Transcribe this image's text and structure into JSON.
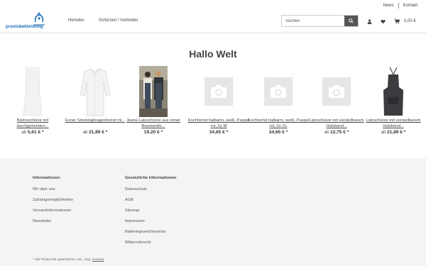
{
  "topbar": {
    "links": [
      "News",
      "Kontakt"
    ]
  },
  "header": {
    "logo_text": "praxisbekleidung",
    "nav": [
      "Hemden",
      "Schürzen / Vorbinder"
    ],
    "search_placeholder": "Suchen",
    "cart_total": "0,00 €"
  },
  "headline": "Hallo Welt",
  "products": [
    {
      "title": "Bistroschürze mit durchgehenden...",
      "prefix": "ab",
      "price": "5,61 € *",
      "image": "apron-white"
    },
    {
      "title": "Exner Smokingkragenhemd mi...",
      "prefix": "ab",
      "price": "21,89 € *",
      "image": "shirt-white"
    },
    {
      "title": "Jeans-Latzschürze aus reiner Baumwolle...",
      "prefix": "",
      "price": "19,20 € *",
      "image": "photo-people"
    },
    {
      "title": "Kochhemd halbarm, weiß, Paspel rot, Gr M",
      "prefix": "",
      "price": "34,65 € *",
      "image": "camera-placeholder"
    },
    {
      "title": "Kochhemd halbarm, weiß, Paspel rot, Gr XL",
      "prefix": "",
      "price": "34,65 € *",
      "image": "camera-placeholder"
    },
    {
      "title": "Latzschürze mit verstellbarem Halsband...",
      "prefix": "ab",
      "price": "12,75 € *",
      "image": "camera-placeholder"
    },
    {
      "title": "Latzschürze mit verstellbarem Halsband...",
      "prefix": "ab",
      "price": "21,89 € *",
      "image": "apron-dark"
    }
  ],
  "footer": {
    "col1": {
      "heading": "Informationen",
      "links": [
        "Wir über uns",
        "Zahlungsmöglichkeiten",
        "Versandinformationen",
        "Newsletter"
      ]
    },
    "col2": {
      "heading": "Gesetzliche Informationen",
      "links": [
        "Datenschutz",
        "AGB",
        "Sitemap",
        "Impressum",
        "Batteriegesetzhinweise",
        "Widerrufsrecht"
      ]
    },
    "note_text": "* Alle Preise inkl. gesetzlicher USt., zzgl.",
    "note_link": "Versand"
  },
  "colors": {
    "brand": "#1f6fb8",
    "footer_bg": "#f4f4f4",
    "search_button": "#555555"
  }
}
